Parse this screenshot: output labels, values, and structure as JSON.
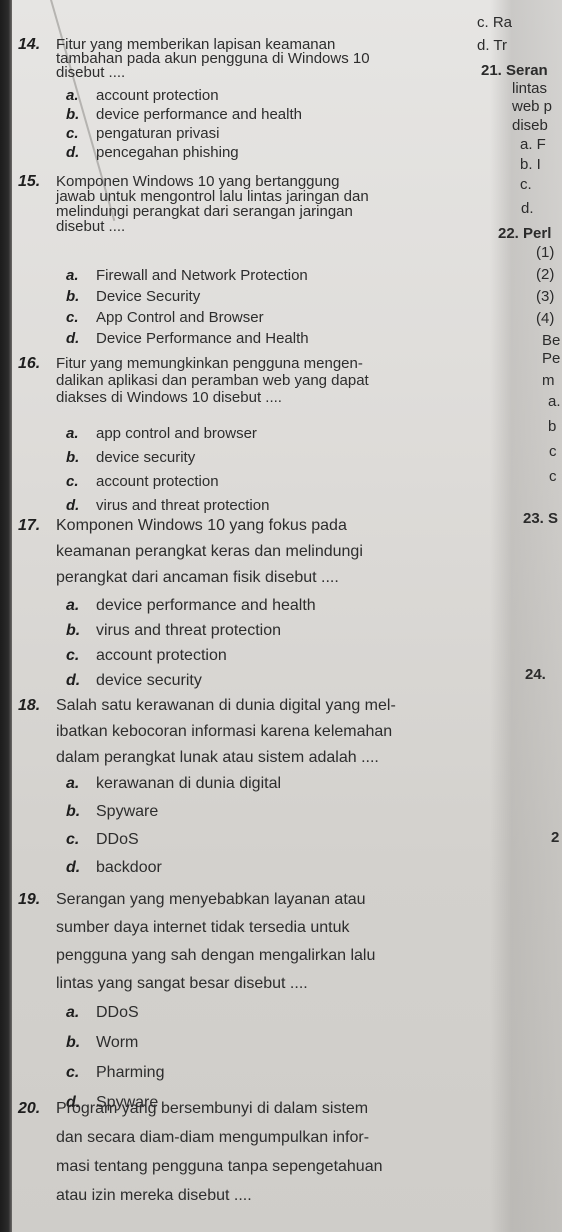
{
  "questions": [
    {
      "number": "14.",
      "text_lines": [
        "Fitur yang memberikan lapisan keamanan",
        "tambahan pada akun pengguna di Windows 10",
        "disebut ...."
      ],
      "options": [
        {
          "letter": "a.",
          "text": "account protection"
        },
        {
          "letter": "b.",
          "text": "device performance and health"
        },
        {
          "letter": "c.",
          "text": "pengaturan privasi"
        },
        {
          "letter": "d.",
          "text": "pencegahan phishing"
        }
      ]
    },
    {
      "number": "15.",
      "text_lines": [
        "Komponen Windows 10 yang bertanggung",
        "jawab untuk mengontrol lalu lintas jaringan dan",
        "melindungi perangkat dari serangan jaringan",
        "disebut ...."
      ],
      "options": [
        {
          "letter": "a.",
          "text": "Firewall and Network Protection"
        },
        {
          "letter": "b.",
          "text": "Device Security"
        },
        {
          "letter": "c.",
          "text": "App Control and Browser"
        },
        {
          "letter": "d.",
          "text": "Device Performance and Health"
        }
      ]
    },
    {
      "number": "16.",
      "text_lines": [
        "Fitur yang memungkinkan pengguna mengen-",
        "dalikan aplikasi dan peramban web yang dapat",
        "diakses di Windows 10 disebut ...."
      ],
      "options": [
        {
          "letter": "a.",
          "text": "app control and browser"
        },
        {
          "letter": "b.",
          "text": "device security"
        },
        {
          "letter": "c.",
          "text": "account protection"
        },
        {
          "letter": "d.",
          "text": "virus and threat protection"
        }
      ]
    },
    {
      "number": "17.",
      "text_lines": [
        "Komponen Windows 10 yang fokus pada",
        "keamanan perangkat keras dan melindungi",
        "perangkat dari ancaman fisik disebut ...."
      ],
      "options": [
        {
          "letter": "a.",
          "text": "device performance and health"
        },
        {
          "letter": "b.",
          "text": "virus and threat protection"
        },
        {
          "letter": "c.",
          "text": "account protection"
        },
        {
          "letter": "d.",
          "text": "device security"
        }
      ]
    },
    {
      "number": "18.",
      "text_lines": [
        "Salah satu kerawanan di dunia digital yang mel-",
        "ibatkan kebocoran informasi karena kelemahan",
        "dalam perangkat lunak atau sistem adalah ...."
      ],
      "options": [
        {
          "letter": "a.",
          "text": "kerawanan di dunia digital"
        },
        {
          "letter": "b.",
          "text": "Spyware"
        },
        {
          "letter": "c.",
          "text": "DDoS"
        },
        {
          "letter": "d.",
          "text": "backdoor"
        }
      ]
    },
    {
      "number": "19.",
      "text_lines": [
        "Serangan yang menyebabkan layanan atau",
        "sumber daya internet tidak tersedia untuk",
        "pengguna yang sah dengan mengalirkan lalu",
        "lintas yang sangat besar disebut ...."
      ],
      "options": [
        {
          "letter": "a.",
          "text": "DDoS"
        },
        {
          "letter": "b.",
          "text": "Worm"
        },
        {
          "letter": "c.",
          "text": "Pharming"
        },
        {
          "letter": "d.",
          "text": "Spyware"
        }
      ]
    },
    {
      "number": "20.",
      "text_lines": [
        "Program yang bersembunyi di dalam sistem",
        "dan secara diam-diam mengumpulkan infor-",
        "masi tentang pengguna tanpa sepengetahuan",
        "atau izin mereka disebut ...."
      ],
      "options": []
    }
  ],
  "right_column_fragments": [
    {
      "id": "q20c",
      "text": "c.  Ra"
    },
    {
      "id": "q20d",
      "text": "d.  Tr"
    },
    {
      "id": "q21",
      "text": "21. Seran"
    },
    {
      "id": "q21l1",
      "text": "lintas"
    },
    {
      "id": "q21l2",
      "text": "web p"
    },
    {
      "id": "q21l3",
      "text": "diseb"
    },
    {
      "id": "q21a",
      "text": "a.  F"
    },
    {
      "id": "q21b",
      "text": "b.  I"
    },
    {
      "id": "q21c",
      "text": "c."
    },
    {
      "id": "q21d",
      "text": "d."
    },
    {
      "id": "q22",
      "text": "22. Perl"
    },
    {
      "id": "q22s1",
      "text": "(1)"
    },
    {
      "id": "q22s2",
      "text": "(2)"
    },
    {
      "id": "q22s3",
      "text": "(3)"
    },
    {
      "id": "q22s4",
      "text": "(4)"
    },
    {
      "id": "q22l1",
      "text": "Be"
    },
    {
      "id": "q22l2",
      "text": "Pe"
    },
    {
      "id": "q22l3",
      "text": "m"
    },
    {
      "id": "q22a",
      "text": "a."
    },
    {
      "id": "q22b",
      "text": "b"
    },
    {
      "id": "q22c",
      "text": "c"
    },
    {
      "id": "q22d",
      "text": "c"
    },
    {
      "id": "q23",
      "text": "23. S"
    },
    {
      "id": "q24",
      "text": "24."
    },
    {
      "id": "q25",
      "text": "2"
    }
  ]
}
